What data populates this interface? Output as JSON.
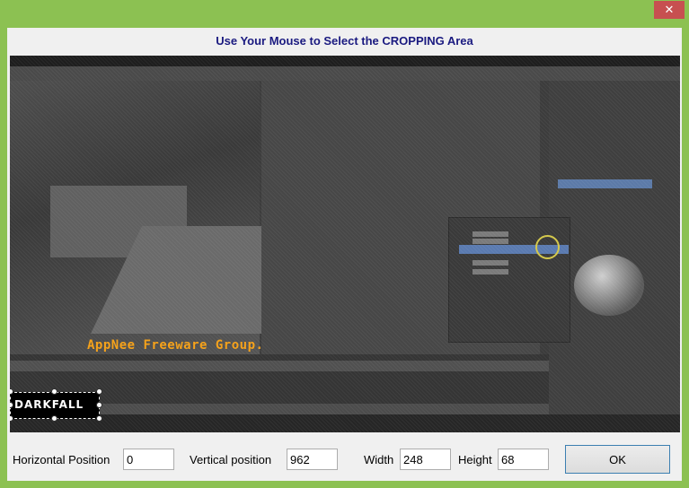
{
  "window": {
    "title": "Use Your Mouse to Select the CROPPING Area",
    "close_glyph": "✕"
  },
  "preview": {
    "watermark": "AppNee Freeware Group.",
    "logo_text": "DARKFALL"
  },
  "fields": {
    "horizontal_label": "Horizontal Position",
    "horizontal_value": "0",
    "vertical_label": "Vertical position",
    "vertical_value": "962",
    "width_label": "Width",
    "width_value": "248",
    "height_label": "Height",
    "height_value": "68"
  },
  "buttons": {
    "ok_label": "OK"
  },
  "colors": {
    "frame": "#8cc152",
    "title_text": "#1a1a80",
    "close": "#c75050",
    "watermark": "#f5a21b"
  }
}
